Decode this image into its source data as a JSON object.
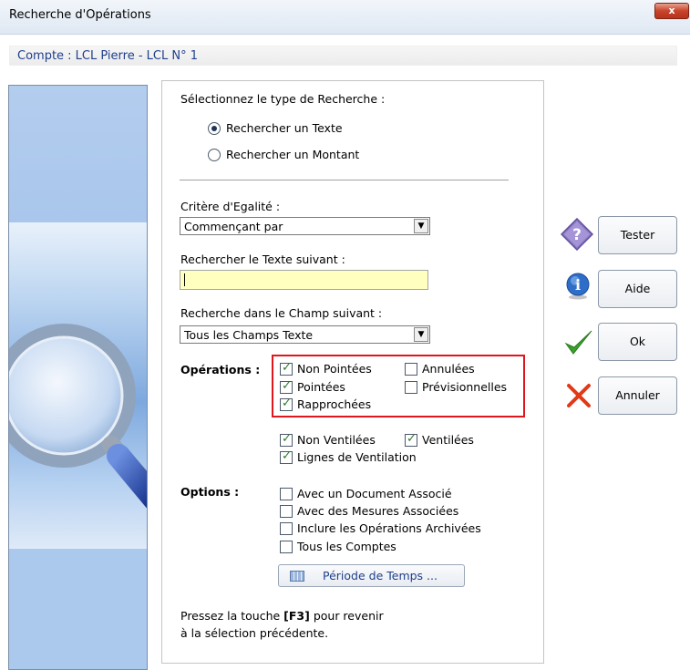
{
  "window": {
    "title": "Recherche d'Opérations",
    "close_glyph": "x"
  },
  "account": {
    "label": "Compte : LCL Pierre - LCL N° 1"
  },
  "search_type": {
    "heading": "Sélectionnez le type de Recherche :",
    "options": [
      {
        "label": "Rechercher un Texte",
        "selected": true
      },
      {
        "label": "Rechercher un Montant",
        "selected": false
      }
    ]
  },
  "criteria": {
    "label": "Critère d'Egalité :",
    "value": "Commençant par"
  },
  "search_text": {
    "label": "Rechercher le Texte suivant :",
    "value": ""
  },
  "field": {
    "label": "Recherche dans le Champ suivant :",
    "value": "Tous les Champs Texte"
  },
  "operations": {
    "label": "Opérations :",
    "items": [
      {
        "label": "Non Pointées",
        "checked": true
      },
      {
        "label": "Annulées",
        "checked": false
      },
      {
        "label": "Pointées",
        "checked": true
      },
      {
        "label": "Prévisionnelles",
        "checked": false
      },
      {
        "label": "Rapprochées",
        "checked": true
      }
    ]
  },
  "ventilation": {
    "items": [
      {
        "label": "Non Ventilées",
        "checked": true
      },
      {
        "label": "Ventilées",
        "checked": true
      },
      {
        "label": "Lignes de Ventilation",
        "checked": true
      }
    ]
  },
  "options": {
    "label": "Options :",
    "items": [
      {
        "label": "Avec un Document Associé",
        "checked": false
      },
      {
        "label": "Avec des Mesures Associées",
        "checked": false
      },
      {
        "label": "Inclure les Opérations Archivées",
        "checked": false
      },
      {
        "label": "Tous les Comptes",
        "checked": false
      }
    ]
  },
  "period_button": {
    "label": "Période de Temps ..."
  },
  "footer": {
    "prefix": "Pressez la touche ",
    "key": "[F3]",
    "suffix": " pour revenir",
    "line2": "à la sélection précédente."
  },
  "buttons": {
    "test": "Tester",
    "help": "Aide",
    "ok": "Ok",
    "cancel": "Annuler",
    "test_icon_glyph": "?",
    "help_icon_glyph": "i"
  },
  "colors": {
    "account_text": "#1f3f8c",
    "text_input_bg": "#ffffc0",
    "highlight_border": "#e0161d",
    "ok_check": "#3aa02c",
    "cancel_cross": "#e03a18"
  }
}
